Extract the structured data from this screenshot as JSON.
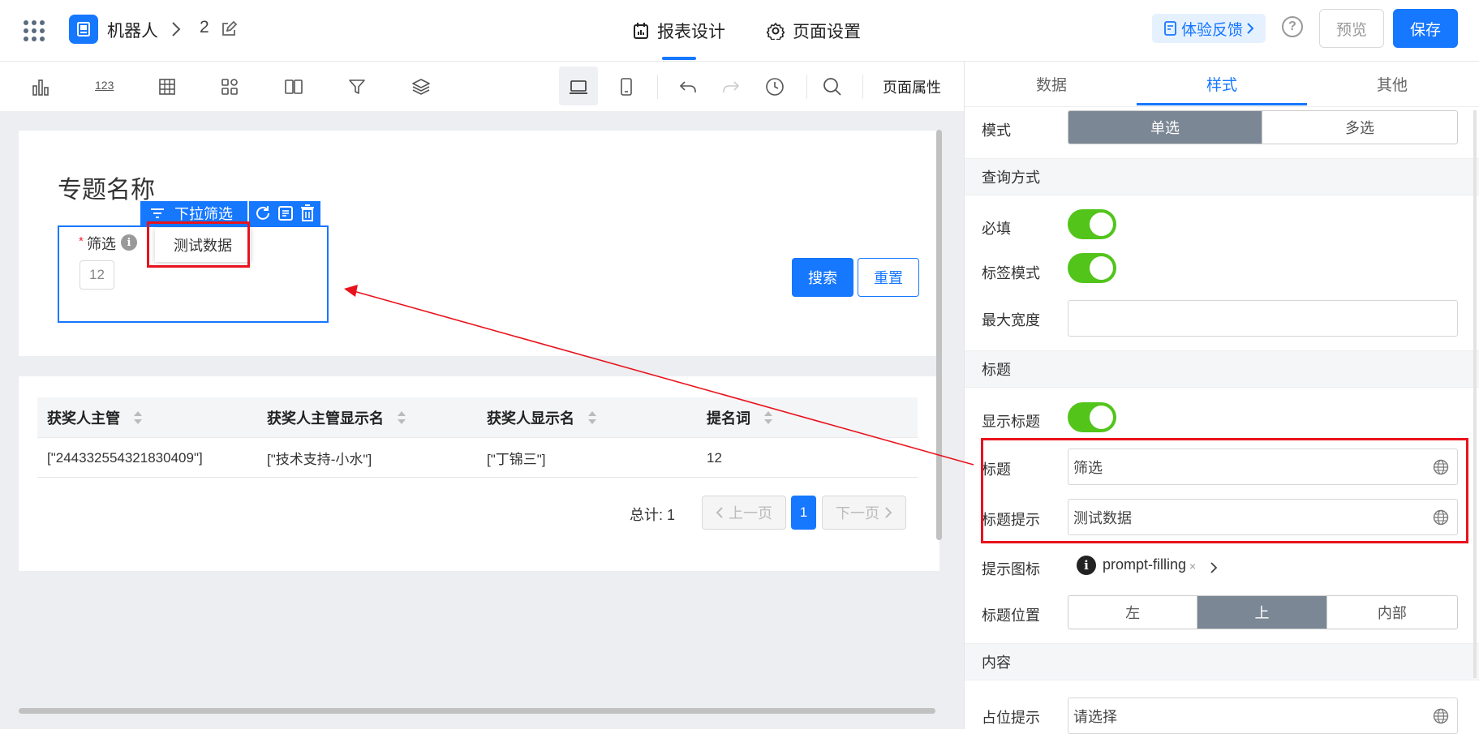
{
  "header": {
    "app_name": "机器人",
    "breadcrumb_page": "2",
    "tabs": [
      {
        "label": "报表设计",
        "active": true,
        "icon": "report-icon"
      },
      {
        "label": "页面设置",
        "active": false,
        "icon": "gear-icon"
      }
    ],
    "feedback_label": "体验反馈",
    "help_symbol": "?",
    "preview_label": "预览",
    "save_label": "保存",
    "accent_color": "#1677ff"
  },
  "toolbar": {
    "tools": [
      "bar-chart-icon",
      "number-icon",
      "table-icon",
      "grid-icon",
      "columns-icon",
      "filter-icon",
      "layers-icon"
    ],
    "number_text": "123",
    "page_properties_label": "页面属性"
  },
  "canvas": {
    "section_title": "专题名称",
    "component_label": "下拉筛选",
    "filter": {
      "required_mark": "*",
      "label": "筛选",
      "info_symbol": "i",
      "tooltip": "测试数据",
      "value": "12"
    },
    "search_label": "搜索",
    "reset_label": "重置",
    "table": {
      "columns": [
        "获奖人主管",
        "获奖人主管显示名",
        "获奖人显示名",
        "提名词"
      ],
      "rows": [
        [
          "[\"244332554321830409\"]",
          "[\"技术支持-小水\"]",
          "[\"丁锦三\"]",
          "12"
        ]
      ]
    },
    "pagination": {
      "total": "总计: 1",
      "prev_label": "上一页",
      "current_page": "1",
      "next_label": "下一页"
    }
  },
  "panel": {
    "tabs": [
      {
        "label": "数据",
        "active": false
      },
      {
        "label": "样式",
        "active": true
      },
      {
        "label": "其他",
        "active": false
      }
    ],
    "mode_label": "模式",
    "mode_options": [
      "单选",
      "多选"
    ],
    "mode_selected": "单选",
    "query_section": "查询方式",
    "required_label": "必填",
    "required_on": true,
    "tag_mode_label": "标签模式",
    "tag_mode_on": true,
    "max_width_label": "最大宽度",
    "max_width_value": "",
    "title_section": "标题",
    "show_title_label": "显示标题",
    "show_title_on": true,
    "title_label": "标题",
    "title_value": "筛选",
    "title_tip_label": "标题提示",
    "title_tip_value": "测试数据",
    "tip_icon_label": "提示图标",
    "tip_icon_info": "i",
    "tip_icon_value": "prompt-filling",
    "tip_icon_clear": "×",
    "title_position_label": "标题位置",
    "title_position_options": [
      "左",
      "上",
      "内部"
    ],
    "title_position_selected": "上",
    "content_section": "内容",
    "placeholder_label": "占位提示",
    "placeholder_value": "请选择",
    "toggle_color": "#52c41a",
    "segment_selected_color": "#7b8794"
  },
  "annotation_color": "#e8131d"
}
